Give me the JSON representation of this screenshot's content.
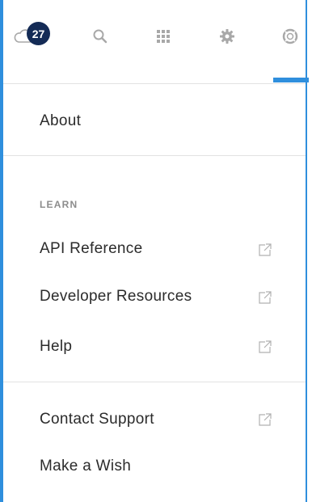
{
  "header": {
    "notification_count": "27",
    "icons": [
      "cloud-icon",
      "search-icon",
      "apps-grid-icon",
      "gear-icon",
      "help-lifebuoy-icon"
    ],
    "active_tab": "help"
  },
  "menu": {
    "about": "About",
    "learn_label": "LEARN",
    "api_reference": "API Reference",
    "developer_resources": "Developer Resources",
    "help": "Help",
    "contact_support": "Contact Support",
    "make_a_wish": "Make a Wish"
  },
  "colors": {
    "accent": "#2f8fdd",
    "badge": "#142b56",
    "icon_gray": "#a8a8a8",
    "divider": "#e2e2e2",
    "text": "#2b2b2b"
  }
}
